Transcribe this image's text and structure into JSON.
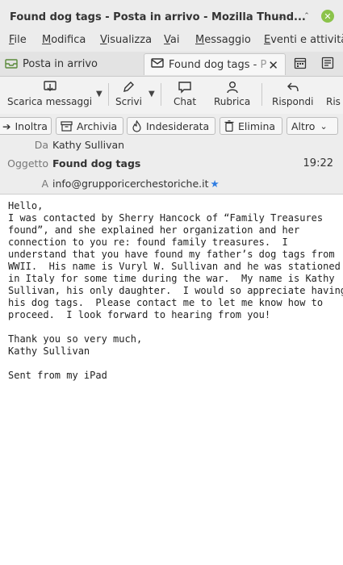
{
  "window": {
    "title": "Found dog tags - Posta in arrivo - Mozilla Thund..."
  },
  "menu": [
    {
      "u": "F",
      "rest": "ile"
    },
    {
      "u": "M",
      "rest": "odifica"
    },
    {
      "u": "V",
      "rest": "isualizza"
    },
    {
      "u": "V",
      "rest": "ai"
    },
    {
      "u": "M",
      "rest": "essaggio"
    },
    {
      "u": "E",
      "rest": "venti e attività"
    }
  ],
  "tabs": {
    "inbox": "Posta in arrivo",
    "active": "Found dog tags - ",
    "active_fade": "P"
  },
  "toolbar": {
    "get_messages": "Scarica messaggi",
    "write": "Scrivi",
    "chat": "Chat",
    "address_book": "Rubrica",
    "reply": "Rispondi",
    "reply_all": "Ris"
  },
  "header_actions": {
    "forward": "Inoltra",
    "archive": "Archivia",
    "junk": "Indesiderata",
    "delete": "Elimina",
    "more": "Altro"
  },
  "message": {
    "from_label": "Da",
    "from": "Kathy Sullivan",
    "subject_label": "Oggetto",
    "subject": "Found dog tags",
    "time": "19:22",
    "to_label": "A",
    "to": "info@grupporicerchestoriche.it",
    "body": "Hello,\nI was contacted by Sherry Hancock of “Family Treasures\nfound”, and she explained her organization and her\nconnection to you re: found family treasures.  I\nunderstand that you have found my father’s dog tags from\nWWII.  His name is Vuryl W. Sullivan and he was stationed\nin Italy for some time during the war.  My name is Kathy\nSullivan, his only daughter.  I would so appreciate having\nhis dog tags.  Please contact me to let me know how to\nproceed.  I look forward to hearing from you!\n\nThank you so very much,\nKathy Sullivan\n\nSent from my iPad"
  }
}
